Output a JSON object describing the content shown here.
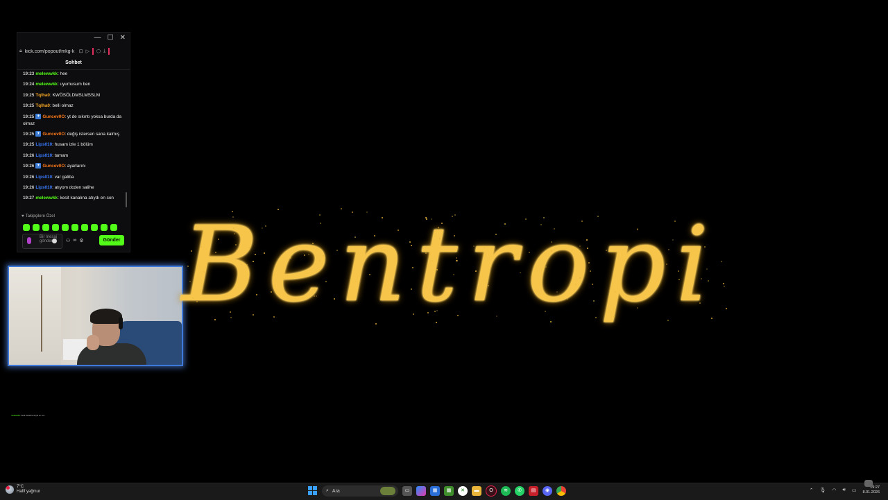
{
  "browser": {
    "url": "kick.com/popout/mkg-k",
    "url_host": "kick.com",
    "url_path": "/popout/mkg-k"
  },
  "chat": {
    "title": "Sohbet",
    "messages": [
      {
        "time": "19:23",
        "user": "melewwkk",
        "text": ": hee",
        "color": "#53fc18"
      },
      {
        "time": "19:24",
        "user": "melewwkk",
        "text": ": uyumusum ben",
        "color": "#53fc18"
      },
      {
        "time": "19:25",
        "user": "Tqlha0",
        "text": ": KWÖSÖLDMSLMSSLM",
        "color": "#f5a623"
      },
      {
        "time": "19:25",
        "user": "Tqlha0",
        "text": ": belli olmaz",
        "color": "#f5a623"
      },
      {
        "time": "19:25",
        "user": "Guncev0O",
        "text": ": yt de sıkıntı yoksa burda da olmaz",
        "color": "#ff7a1a",
        "badge": true
      },
      {
        "time": "19:25",
        "user": "Guncev0O",
        "text": ": değiş istersen sana kalmış",
        "color": "#ff7a1a",
        "badge": true
      },
      {
        "time": "19:25",
        "user": "Lips010",
        "text": ": husam izle 1 bölüm",
        "color": "#3b7cff"
      },
      {
        "time": "19:26",
        "user": "Lips010",
        "text": ": tamam",
        "color": "#3b7cff"
      },
      {
        "time": "19:26",
        "user": "Guncev0O",
        "text": ": ayarlarını",
        "color": "#ff7a1a",
        "badge": true
      },
      {
        "time": "19:26",
        "user": "Lips010",
        "text": ": var galiba",
        "color": "#3b7cff"
      },
      {
        "time": "19:26",
        "user": "Lips010",
        "text": ": atıyom dcden salihe",
        "color": "#3b7cff"
      },
      {
        "time": "19:27",
        "user": "melewwkk",
        "text": ": kesit kanalına atıydı en son",
        "color": "#53fc18"
      }
    ],
    "followers_only_label": "Takipçilere Özel",
    "input_placeholder": "Bir mesaj gönderin",
    "send_label": "Gönder",
    "accent_color": "#53fc18"
  },
  "overlay": {
    "logo_text": "Bentropi",
    "logo_color": "#f6c54a",
    "tiny_user": "melewwkk",
    "tiny_text": ": kesit kanalına atıydı en son"
  },
  "taskbar": {
    "weather_temp": "7°C",
    "weather_desc": "Hafif yağmur",
    "search_label": "Ara",
    "clock_time": "19:27",
    "clock_date": "8.01.2026",
    "apps": [
      "file-explorer-icon",
      "task-view-icon",
      "copilot-icon",
      "store-icon",
      "minecraft-icon",
      "xbox-icon",
      "folder-icon",
      "opera-gx-icon",
      "spotify-icon",
      "whatsapp-icon",
      "news-icon",
      "discord-icon",
      "chrome-icon"
    ]
  }
}
